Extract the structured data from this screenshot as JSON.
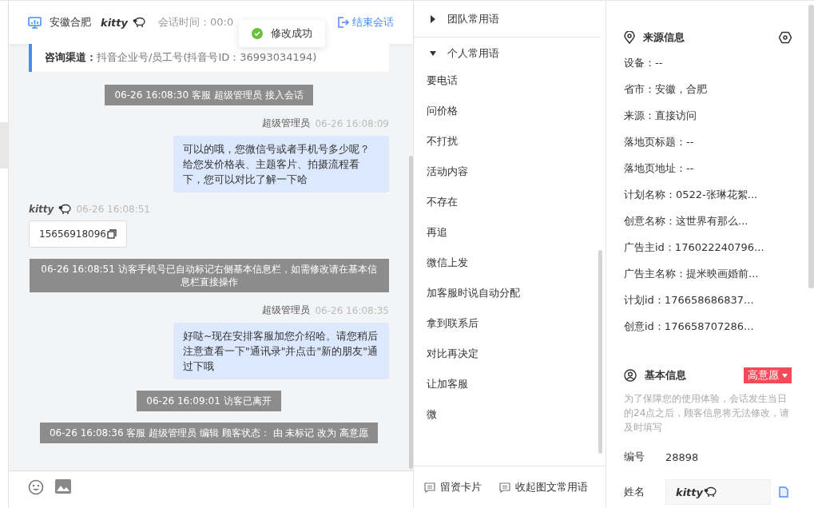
{
  "header": {
    "location": "安徽合肥",
    "visitor": "kitty",
    "session_time": "会话时间：00:0",
    "end_button": "结束会话"
  },
  "toast": {
    "text": "修改成功"
  },
  "channel": {
    "label": "咨询渠道：",
    "value": "抖音企业号/员工号(抖音号ID：36993034194)"
  },
  "messages": [
    {
      "kind": "system",
      "text": "06-26 16:08:30 客服 超级管理员 接入会话"
    },
    {
      "kind": "agent",
      "sender": "超级管理员",
      "time": "06-26 16:08:09",
      "text": "可以的哦，您微信号或者手机号多少呢？给您发价格表、主题客片、拍摄流程看下，您可以对比了解一下哈"
    },
    {
      "kind": "visitor",
      "sender": "kitty",
      "time": "06-26 16:08:51",
      "text": "15656918096"
    },
    {
      "kind": "system",
      "text": "06-26 16:08:51 访客手机号已自动标记右侧基本信息栏，如需修改请在基本信息栏直接操作"
    },
    {
      "kind": "agent",
      "sender": "超级管理员",
      "time": "06-26 16:08:35",
      "text": "好哒~现在安排客服加您介绍哈。请您稍后注意查看一下\"通讯录\"并点击\"新的朋友\"通过下哦"
    },
    {
      "kind": "system",
      "text": "06-26 16:09:01 访客已离开"
    },
    {
      "kind": "system",
      "text": "06-26 16:08:36 客服 超级管理员 编辑 顾客状态： 由 未标记 改为 高意愿"
    }
  ],
  "phrases": {
    "groups": [
      {
        "label": "团队常用语",
        "expanded": false
      },
      {
        "label": "个人常用语",
        "expanded": true
      }
    ],
    "items": [
      "要电话",
      "问价格",
      "不打扰",
      "活动内容",
      "不存在",
      "再追",
      "微信上发",
      "加客服时说自动分配",
      "拿到联系后",
      "对比再决定",
      "让加客服",
      "微"
    ]
  },
  "bottom_actions": [
    "留资卡片",
    "收起图文常用语"
  ],
  "source_info": {
    "title": "来源信息",
    "rows": [
      "设备：--",
      "省市：安徽，合肥",
      "来源：直接访问",
      "落地页标题：--",
      "落地页地址：--",
      "计划名称：0522-张琳花絮...",
      "创意名称：这世界有那么...",
      "广告主id：176022240796...",
      "广告主名称：提米映画婚前...",
      "计划id：176658686837...",
      "创意id：176658707286..."
    ]
  },
  "basic_info": {
    "title": "基本信息",
    "status": "高意愿",
    "note": "为了保障您的使用体验，会话发生当日的24点之后，顾客信息将无法修改，请及时填写",
    "fields": [
      {
        "label": "编号",
        "value": "28898",
        "kind": "text"
      },
      {
        "label": "姓名",
        "value": "kitty",
        "kind": "input"
      }
    ]
  }
}
